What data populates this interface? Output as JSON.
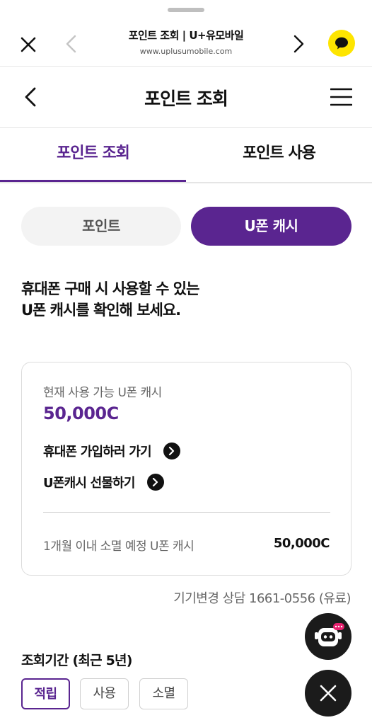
{
  "browser": {
    "title": "포인트 조회 | U+유모바일",
    "url": "www.uplusumobile.com"
  },
  "header": {
    "title": "포인트 조회"
  },
  "tabs": [
    {
      "label": "포인트 조회",
      "active": true
    },
    {
      "label": "포인트 사용",
      "active": false
    }
  ],
  "toggle": {
    "options": [
      "포인트",
      "U폰 캐시"
    ],
    "selected": "U폰 캐시"
  },
  "headline": {
    "line1": "휴대폰 구매 시 사용할 수 있는",
    "line2": "U폰 캐시를 확인해 보세요."
  },
  "card": {
    "available_label": "현재 사용 가능 U폰 캐시",
    "available_amount": "50,000C",
    "link_join": "휴대폰 가입하러 가기",
    "link_gift": "U폰캐시 선물하기",
    "expiring_label": "1개월 이내 소멸 예정 U폰 캐시",
    "expiring_amount": "50,000C"
  },
  "consult": "기기변경 상담 1661-0556 (유료)",
  "period": {
    "title": "조회기간 (최근 5년)",
    "chips": [
      "적립",
      "사용",
      "소멸"
    ],
    "selected": "적립"
  },
  "colors": {
    "accent": "#5a2590",
    "kakao": "#fee500",
    "fab": "#1b1b1b",
    "bot_badge": "#e6206e"
  },
  "icons": {
    "close": "close-icon",
    "back": "chevron-left-icon",
    "forward": "chevron-right-icon",
    "kakao": "kakao-talk-icon",
    "menu": "hamburger-menu-icon",
    "link_arrow": "arrow-circle-right-icon",
    "chatbot": "chatbot-robot-icon",
    "fab_close": "close-icon"
  }
}
